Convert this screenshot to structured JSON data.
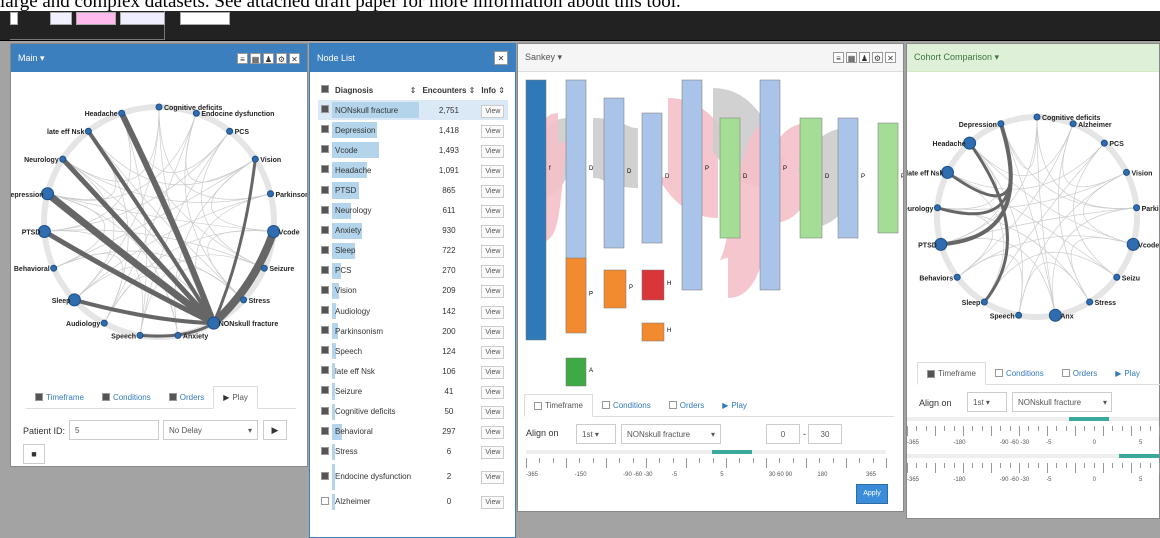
{
  "caption": "large and complex datasets. See attached draft paper for more information about this tool.",
  "main": {
    "title": "Main",
    "tabs": [
      "Timeframe",
      "Conditions",
      "Orders",
      "Play"
    ],
    "patient_label": "Patient ID:",
    "patient_value": "5",
    "delay": "No Delay",
    "nodes": [
      "Cognitive deficits",
      "Endocine dysfunction",
      "PCS",
      "Vision",
      "Parkinsonism",
      "Vcode",
      "Seizure",
      "Stress",
      "NONskull fracture",
      "Anxiety",
      "Speech",
      "Audiology",
      "Sleep",
      "Behavioral",
      "PTSD",
      "Depression",
      "Neurology",
      "late eff Nsk",
      "Headache"
    ]
  },
  "nodelist": {
    "title": "Node List",
    "headers": [
      "Diagnosis",
      "Encounters",
      "Info"
    ],
    "rows": [
      [
        "NONskull fracture",
        "2,751",
        1
      ],
      [
        "Depression",
        "1,418",
        0.52
      ],
      [
        "Vcode",
        "1,493",
        0.54
      ],
      [
        "Headache",
        "1,091",
        0.4
      ],
      [
        "PTSD",
        "865",
        0.31
      ],
      [
        "Neurology",
        "611",
        0.22
      ],
      [
        "Anxiety",
        "930",
        0.34
      ],
      [
        "Sleep",
        "722",
        0.26
      ],
      [
        "PCS",
        "270",
        0.1
      ],
      [
        "Vision",
        "209",
        0.08
      ],
      [
        "Audiology",
        "142",
        0.05
      ],
      [
        "Parkinsonism",
        "200",
        0.07
      ],
      [
        "Speech",
        "124",
        0.05
      ],
      [
        "late eff Nsk",
        "106",
        0.04
      ],
      [
        "Seizure",
        "41",
        0.02
      ],
      [
        "Cognitive deficits",
        "50",
        0.02
      ],
      [
        "Behavioral",
        "297",
        0.11
      ],
      [
        "Stress",
        "6",
        0.01
      ],
      [
        "Endocine dysfunction",
        "2",
        0.01
      ],
      [
        "Alzheimer",
        "0",
        0
      ]
    ],
    "view": "View"
  },
  "sankey": {
    "title": "Sankey",
    "tabs": [
      "Timeframe",
      "Conditions",
      "Orders",
      "Play"
    ],
    "align_label": "Align on",
    "align_nth": "1st",
    "align_node": "NONskull fracture",
    "range_from": "0",
    "range_to": "30",
    "apply": "Apply",
    "ticks": [
      "-365",
      "-150",
      "-90 -60 -30",
      "-5",
      "5",
      "30 60 90",
      "180",
      "365"
    ],
    "nodelabels": [
      "f",
      "D",
      "D",
      "D",
      "P",
      "D",
      "P",
      "D",
      "P",
      "P",
      "P",
      "P",
      "H",
      "H",
      "A",
      "H",
      "T"
    ]
  },
  "cohort": {
    "title": "Cohort Comparison",
    "tabs": [
      "Timeframe",
      "Conditions",
      "Orders",
      "Play"
    ],
    "align_label": "Align on",
    "align_nth": "1st",
    "align_node": "NONskull fracture",
    "ticks": [
      "-365",
      "-180",
      "-90 -60 -30",
      "-5",
      "0",
      "5"
    ],
    "nodes": [
      "Cognitive deficits",
      "Alzheimer",
      "PCS",
      "Vision",
      "Parkinson",
      "Vcode",
      "Seizu",
      "Stress",
      "Anx",
      "Speech",
      "Sleep",
      "Behaviors",
      "PTSD",
      "Neurology",
      "late eff Nsk",
      "Headache",
      "Depression"
    ]
  },
  "colors": {
    "header_blue": "#3c7fbf",
    "bar_blue": "#b3d4ea",
    "node_blue": "#2f6db0",
    "sankey_blue": "#a9c4e8",
    "sankey_green": "#a3dd96",
    "sankey_orange": "#f28a30",
    "sankey_red": "#d9363a",
    "sankey_darkgreen": "#3daa45"
  }
}
